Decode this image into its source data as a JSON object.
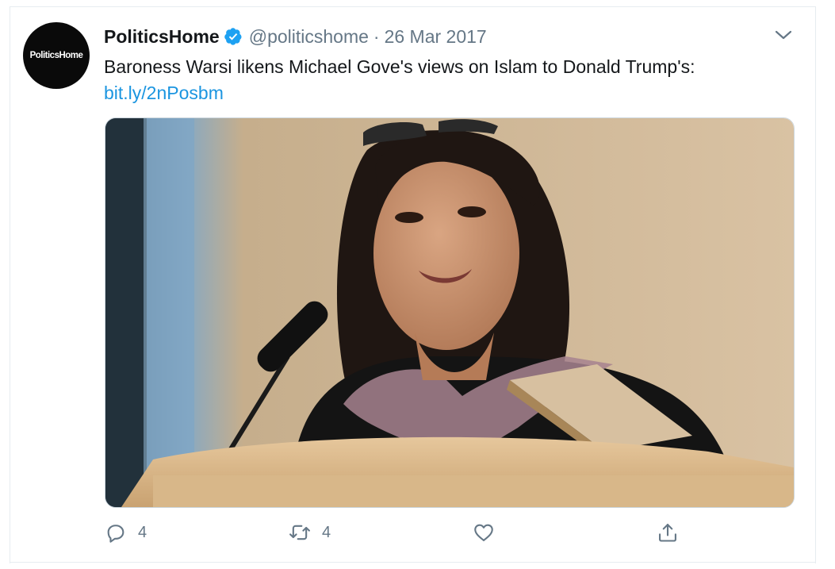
{
  "tweet": {
    "avatar_text": "PoliticsHome",
    "name": "PoliticsHome",
    "handle": "@politicshome",
    "separator": "·",
    "date": "26 Mar 2017",
    "text": "Baroness Warsi likens Michael Gove's views on Islam to Donald Trump's:",
    "link": "bit.ly/2nPosbm"
  },
  "actions": {
    "reply_count": "4",
    "retweet_count": "4"
  },
  "icons": {
    "verified": "verified-badge-icon",
    "caret": "chevron-down-icon",
    "reply": "reply-icon",
    "retweet": "retweet-icon",
    "like": "heart-icon",
    "share": "share-icon"
  },
  "colors": {
    "verified": "#1da1f2",
    "link": "#1b95e0",
    "secondary_text": "#657786"
  }
}
